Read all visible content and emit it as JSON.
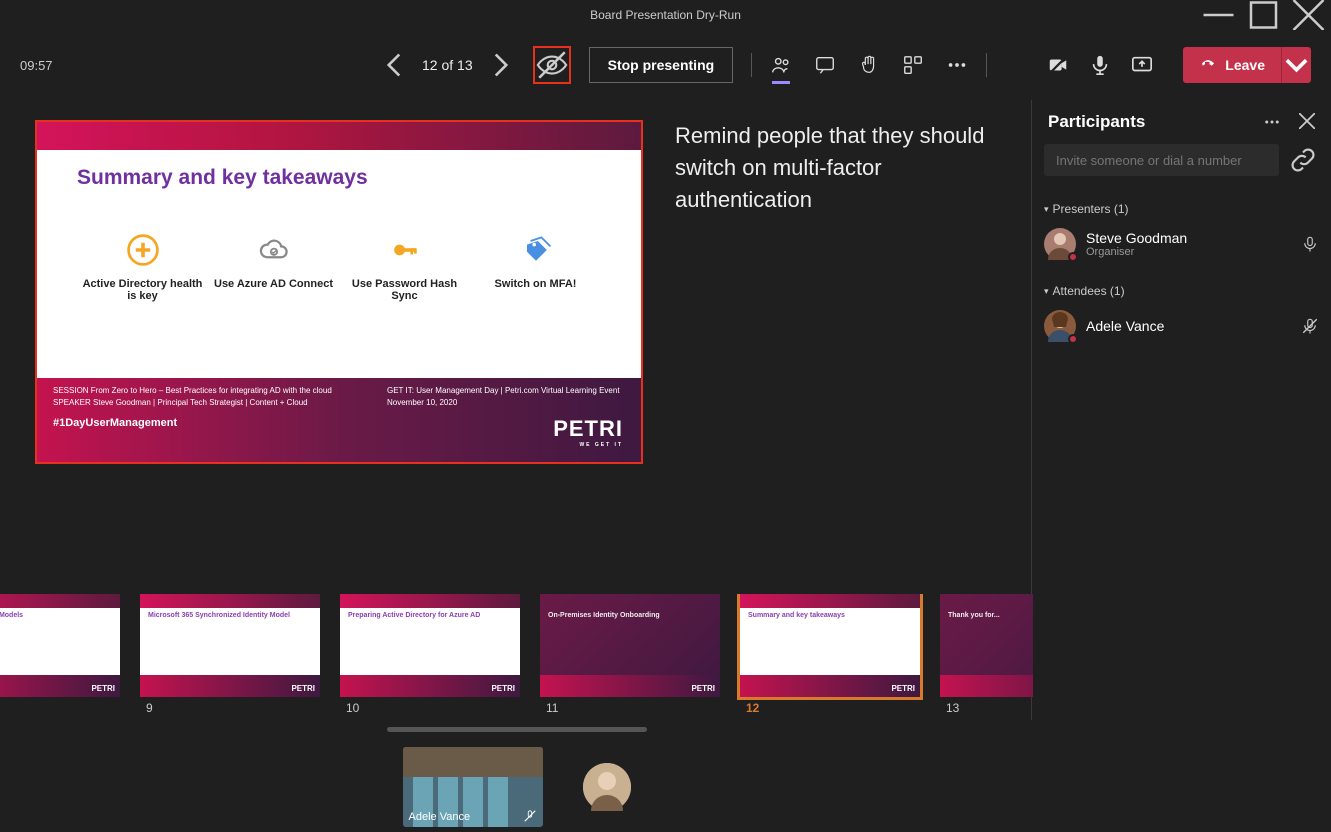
{
  "window": {
    "title": "Board Presentation Dry-Run"
  },
  "timer": "09:57",
  "slideNav": {
    "label": "12 of 13"
  },
  "toolbar": {
    "stopPresenting": "Stop presenting"
  },
  "leave": {
    "label": "Leave"
  },
  "speakerNote": "Remind people that they should switch on multi-factor authentication",
  "slide": {
    "title": "Summary and key takeaways",
    "items": [
      {
        "label": "Active Directory health is key"
      },
      {
        "label": "Use Azure AD Connect"
      },
      {
        "label": "Use Password Hash Sync"
      },
      {
        "label": "Switch on MFA!"
      }
    ],
    "footer": {
      "session": "SESSION  From Zero to Hero – Best Practices for integrating AD with the cloud",
      "speaker": "SPEAKER  Steve Goodman | Principal Tech Strategist | Content + Cloud",
      "event": "GET IT: User Management Day | Petri.com Virtual Learning Event",
      "date": "November 10, 2020",
      "hashtag": "#1DayUserManagement",
      "brand": "PETRI",
      "brandSub": "WE GET IT"
    }
  },
  "thumbs": [
    {
      "number": "",
      "selected": false,
      "white": true,
      "title": "onized Identity Models"
    },
    {
      "number": "9",
      "selected": false,
      "white": true,
      "title": "Microsoft 365 Synchronized Identity Model"
    },
    {
      "number": "10",
      "selected": false,
      "white": true,
      "title": "Preparing Active Directory for Azure AD"
    },
    {
      "number": "11",
      "selected": false,
      "white": false,
      "title": "On-Premises Identity Onboarding"
    },
    {
      "number": "12",
      "selected": true,
      "white": true,
      "title": "Summary and key takeaways"
    },
    {
      "number": "13",
      "selected": false,
      "white": false,
      "title": "Thank you for..."
    }
  ],
  "participants": {
    "title": "Participants",
    "invitePlaceholder": "Invite someone or dial a number",
    "presentersLabel": "Presenters (1)",
    "attendeesLabel": "Attendees (1)",
    "presenters": [
      {
        "name": "Steve Goodman",
        "role": "Organiser",
        "avatarColor": "#a87c6f",
        "presence": "#c4314b"
      }
    ],
    "attendees": [
      {
        "name": "Adele Vance",
        "role": "",
        "avatarColor": "#8a5a3c",
        "presence": "#c4314b"
      }
    ]
  },
  "videoTile": {
    "name": "Adele Vance"
  }
}
